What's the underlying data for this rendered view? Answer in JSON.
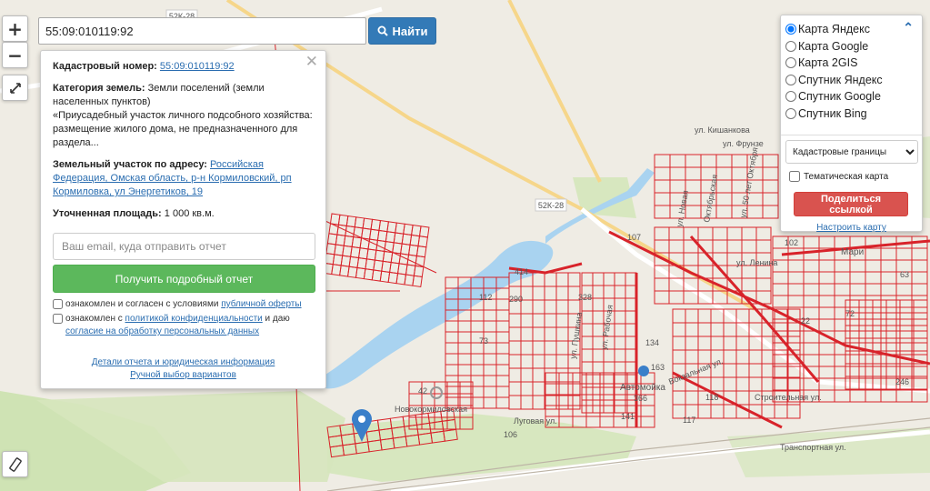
{
  "search": {
    "value": "55:09:010119:92",
    "button_label": "Найти"
  },
  "zoom": {
    "in_label": "+",
    "out_label": "−"
  },
  "info": {
    "cadastral_label": "Кадастровый номер:",
    "cadastral_number": "55:09:010119:92",
    "category_label": "Категория земель:",
    "category_value": "Земли поселений (земли населенных пунктов)",
    "usage_text": "«Приусадебный участок личного подсобного хозяйства: размещение жилого дома, не предназначенного для раздела...",
    "address_label": "Земельный участок по адресу:",
    "address_value": "Российская Федерация, Омская область, р-н Кормиловский, рп Кормиловка, ул Энергетиков, 19",
    "area_label": "Уточненная площадь:",
    "area_value": "1 000 кв.м.",
    "email_placeholder": "Ваш email, куда отправить отчет",
    "report_button": "Получить подробный отчет",
    "consent1_text": "ознакомлен и согласен с условиями",
    "consent1_link": "публичной оферты",
    "consent2_text": "ознакомлен с",
    "consent2_link1": "политикой конфиденциальности",
    "consent2_mid": "и даю",
    "consent2_link2": "согласие на обработку персональных данных",
    "details_link": "Детали отчета и юридическая информация",
    "manual_link": "Ручной выбор вариантов"
  },
  "layers": {
    "options": [
      {
        "label": "Карта Яндекс",
        "selected": true
      },
      {
        "label": "Карта Google",
        "selected": false
      },
      {
        "label": "Карта 2GIS",
        "selected": false
      },
      {
        "label": "Спутник Яндекс",
        "selected": false
      },
      {
        "label": "Спутник Google",
        "selected": false
      },
      {
        "label": "Спутник Bing",
        "selected": false
      }
    ],
    "borders_select": "Кадастровые границы",
    "thematic_label": "Тематическая карта",
    "share_button": "Поделиться ссылкой",
    "configure_link": "Настроить карту"
  },
  "map": {
    "road_badge_1": "52К-28",
    "road_badge_2": "52К-28",
    "streets": [
      "ул. Кишанкова",
      "ул. Фрунзе",
      "ул. 50 лет Октября",
      "ул. Ленина",
      "Октябрьская",
      "ул. Новая",
      "ул. Пушкина",
      "ул. Рабочая",
      "Вокзальная ул.",
      "Новокормиловская",
      "Луговая ул.",
      "Строительная ул.",
      "Транспортная ул."
    ],
    "poi_label": "Автомойка",
    "place_label": "Мари",
    "parcel_numbers": [
      "107",
      "414",
      "290",
      "328",
      "73",
      "134",
      "163",
      "366",
      "141",
      "117",
      "118",
      "106",
      "42",
      "22",
      "72",
      "102",
      "63",
      "246",
      "112"
    ]
  },
  "colors": {
    "parcel": "#d8232a",
    "search_button": "#337ab7",
    "report_button": "#5cb85c",
    "share_button": "#d9534f",
    "water": "#a9d3f0",
    "green": "#cfe3b4"
  }
}
